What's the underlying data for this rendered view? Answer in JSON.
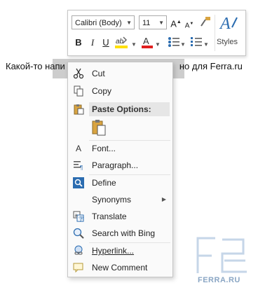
{
  "minibar": {
    "font_name": "Calibri (Body)",
    "font_size": "11",
    "styles_label": "Styles"
  },
  "document": {
    "text_left": "Какой-то напи",
    "text_right": "но для Ferra.ru"
  },
  "context_menu": {
    "cut": "Cut",
    "copy": "Copy",
    "paste_options": "Paste Options:",
    "font": "Font...",
    "paragraph": "Paragraph...",
    "define": "Define",
    "synonyms": "Synonyms",
    "translate": "Translate",
    "search_bing": "Search with Bing",
    "hyperlink": "Hyperlink...",
    "new_comment": "New Comment"
  },
  "watermark": {
    "text": "FERRA.RU"
  },
  "colors": {
    "highlight": "#ffe000",
    "font_color": "#e02020",
    "accent_blue": "#2b6cb0"
  }
}
